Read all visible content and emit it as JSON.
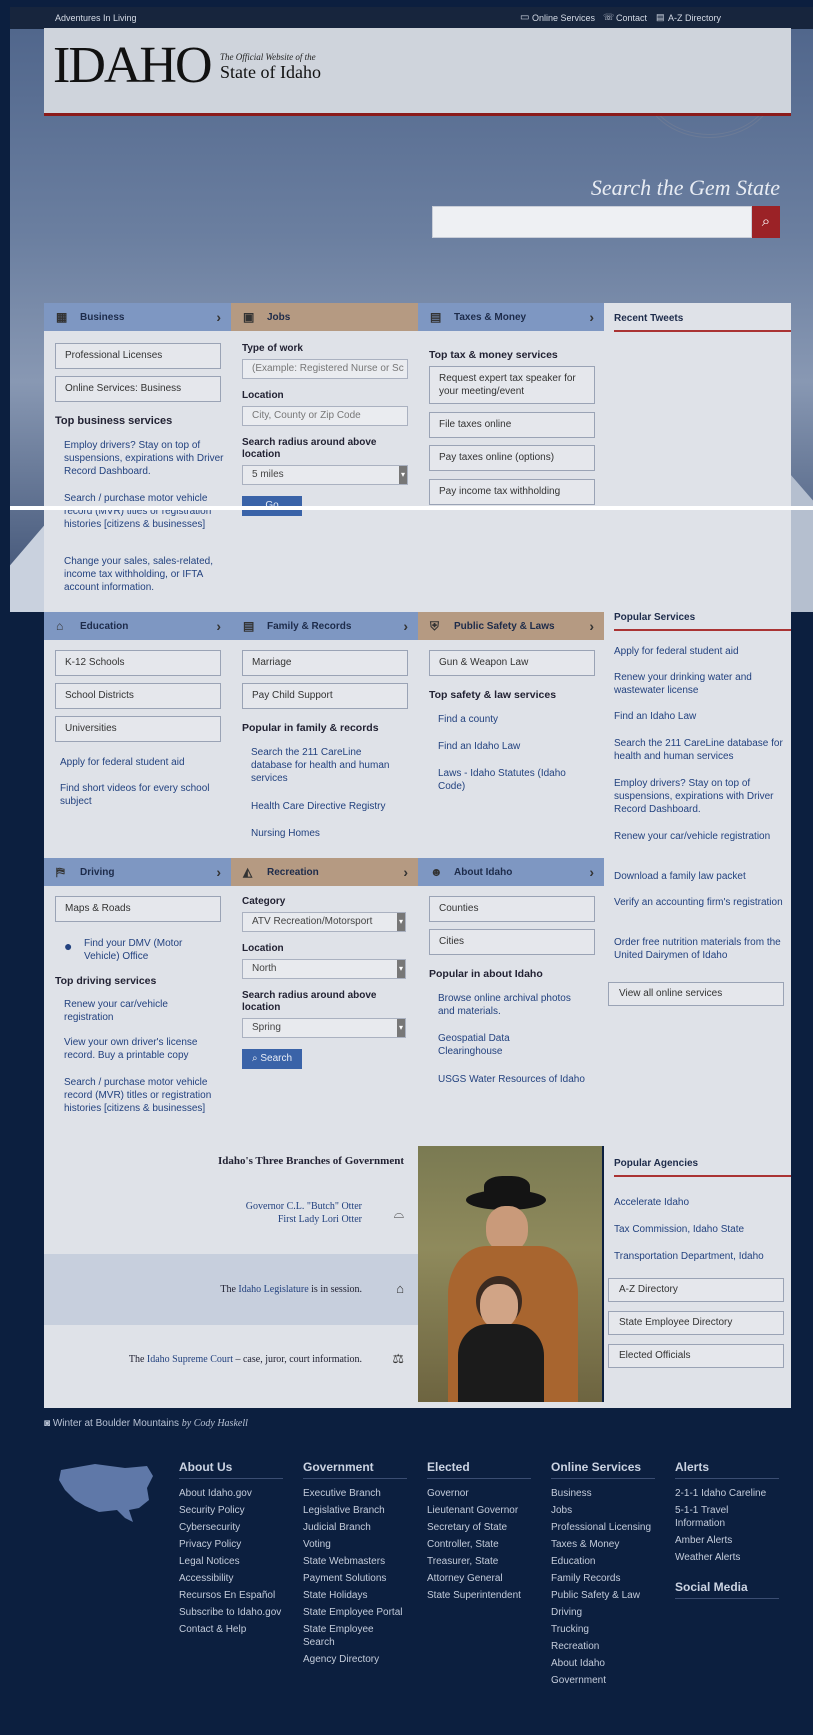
{
  "topbar": {
    "site_tagline": "Adventures In Living",
    "links": [
      "Online Services",
      "Contact",
      "A-Z Directory"
    ]
  },
  "header": {
    "logo_text": "IDAHO",
    "subtitle_small": "The Official Website of the",
    "subtitle_big": "State of Idaho",
    "search_title": "Search the Gem State",
    "search_value": ""
  },
  "business": {
    "title": "Business",
    "buttons": [
      "Professional Licenses",
      "Online Services: Business"
    ],
    "section": "Top business services",
    "links": [
      "Employ drivers? Stay on top of suspensions, expirations with Driver Record Dashboard.",
      "Search / purchase motor vehicle record (MVR) titles or registration histories [citizens & businesses]",
      "Change your sales, sales-related, income tax withholding, or IFTA account information."
    ]
  },
  "jobs": {
    "title": "Jobs",
    "type_label": "Type of work",
    "type_placeholder": "(Example: Registered Nurse or Sc",
    "location_label": "Location",
    "location_placeholder": "City, County or Zip Code",
    "radius_label": "Search radius around above location",
    "radius_value": "5 miles",
    "go_label": "Go"
  },
  "taxes": {
    "title": "Taxes & Money",
    "section": "Top tax & money services",
    "buttons": [
      "Request expert tax speaker for your meeting/event",
      "File taxes online",
      "Pay taxes online (options)",
      "Pay income tax withholding"
    ]
  },
  "tweets": {
    "title": "Recent Tweets"
  },
  "education": {
    "title": "Education",
    "buttons": [
      "K-12 Schools",
      "School Districts",
      "Universities"
    ],
    "links": [
      "Apply for federal student aid",
      "Find short videos for every school subject"
    ]
  },
  "family": {
    "title": "Family & Records",
    "buttons": [
      "Marriage",
      "Pay Child Support"
    ],
    "section": "Popular in family & records",
    "links": [
      "Search the 211 CareLine database for health and human services",
      "Health Care Directive Registry",
      "Nursing Homes"
    ]
  },
  "safety": {
    "title": "Public Safety & Laws",
    "buttons": [
      "Gun & Weapon Law"
    ],
    "section": "Top safety & law services",
    "links": [
      "Find a county",
      "Find an Idaho Law",
      "Laws - Idaho Statutes (Idaho Code)"
    ]
  },
  "popular_services": {
    "title": "Popular Services",
    "links": [
      "Apply for federal student aid",
      "Renew your drinking water and wastewater license",
      "Find an Idaho Law",
      "Search the 211 CareLine database for health and human services",
      "Employ drivers? Stay on top of suspensions, expirations with Driver Record Dashboard.",
      "Renew your car/vehicle registration",
      "Download a family law packet",
      "Verify an accounting firm's registration",
      "Order free nutrition materials from the United Dairymen of Idaho"
    ],
    "view_all": "View all online services"
  },
  "driving": {
    "title": "Driving",
    "buttons": [
      "Maps & Roads"
    ],
    "dmv_link": "Find your DMV (Motor Vehicle) Office",
    "section": "Top driving services",
    "links": [
      "Renew your car/vehicle registration",
      "View your own driver's license record. Buy a printable copy",
      "Search / purchase motor vehicle record (MVR) titles or registration histories [citizens & businesses]"
    ]
  },
  "recreation": {
    "title": "Recreation",
    "category_label": "Category",
    "category_value": "ATV Recreation/Motorsport",
    "location_label": "Location",
    "location_value": "North",
    "radius_label": "Search radius around above location",
    "radius_value": "Spring",
    "search_label": "Search"
  },
  "about": {
    "title": "About Idaho",
    "buttons": [
      "Counties",
      "Cities"
    ],
    "section": "Popular in about Idaho",
    "links": [
      "Browse online archival photos and materials.",
      "Geospatial Data Clearinghouse",
      "USGS Water Resources of Idaho"
    ]
  },
  "government": {
    "title": "Idaho's Three Branches of Government",
    "governor_link": "Governor C.L. \"Butch\" Otter",
    "first_lady_link": "First Lady Lori Otter",
    "legislature_prefix": "The ",
    "legislature_link": "Idaho Legislature",
    "legislature_suffix": " is in session.",
    "court_prefix": "The ",
    "court_link": "Idaho Supreme Court",
    "court_suffix": " – case, juror, court information."
  },
  "agencies": {
    "title": "Popular Agencies",
    "links": [
      "Accelerate Idaho",
      "Tax Commission, Idaho State",
      "Transportation Department, Idaho"
    ],
    "buttons": [
      "A-Z Directory",
      "State Employee Directory",
      "Elected Officials"
    ]
  },
  "photo_caption": {
    "title": "Winter at Boulder Mountains",
    "by": "by Cody Haskell"
  },
  "footer": {
    "about": {
      "title": "About Us",
      "items": [
        "About Idaho.gov",
        "Security Policy",
        "Cybersecurity",
        "Privacy Policy",
        "Legal Notices",
        "Accessibility",
        "Recursos En Español",
        "Subscribe to Idaho.gov",
        "Contact & Help"
      ]
    },
    "gov": {
      "title": "Government",
      "items": [
        "Executive Branch",
        "Legislative Branch",
        "Judicial Branch",
        "Voting",
        "State Webmasters",
        "Payment Solutions",
        "State Holidays",
        "State Employee Portal",
        "State Employee Search",
        "Agency Directory"
      ]
    },
    "elected": {
      "title": "Elected",
      "items": [
        "Governor",
        "Lieutenant Governor",
        "Secretary of State",
        "Controller, State",
        "Treasurer, State",
        "Attorney General",
        "State Superintendent"
      ]
    },
    "online": {
      "title": "Online Services",
      "items": [
        "Business",
        "Jobs",
        "Professional Licensing",
        "Taxes & Money",
        "Education",
        "Family Records",
        "Public Safety & Law",
        "Driving",
        "Trucking",
        "Recreation",
        "About Idaho",
        "Government"
      ]
    },
    "alerts": {
      "title": "Alerts",
      "items": [
        "2-1-1 Idaho Careline",
        "5-1-1 Travel Information",
        "Amber Alerts",
        "Weather Alerts"
      ]
    },
    "social": {
      "title": "Social Media"
    }
  }
}
